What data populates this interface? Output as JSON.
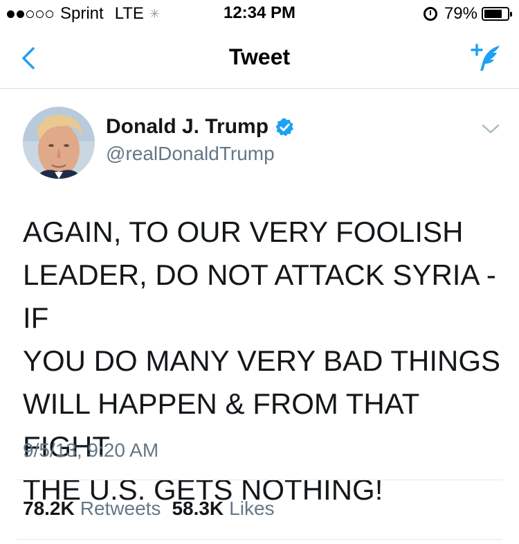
{
  "status_bar": {
    "carrier": "Sprint",
    "network": "LTE",
    "time": "12:34 PM",
    "battery_percent": "79%",
    "battery_level": 0.79,
    "signal_bars_filled": 2,
    "signal_bars_total": 5
  },
  "nav": {
    "title": "Tweet",
    "back_icon": "chevron-left-icon",
    "compose_icon": "compose-tweet-icon"
  },
  "tweet": {
    "display_name": "Donald J. Trump",
    "username": "@realDonaldTrump",
    "verified": true,
    "text_lines": [
      "AGAIN, TO OUR VERY FOOLISH",
      "LEADER, DO NOT ATTACK SYRIA - IF",
      "YOU DO MANY VERY BAD THINGS",
      "WILL HAPPEN & FROM THAT FIGHT",
      "THE U.S. GETS NOTHING!"
    ],
    "timestamp": "9/5/13, 9:20 AM"
  },
  "stats": {
    "retweets_count": "78.2K",
    "retweets_label": "Retweets",
    "likes_count": "58.3K",
    "likes_label": "Likes"
  },
  "colors": {
    "accent": "#1da1f2",
    "primary_text": "#14171a",
    "secondary_text": "#657786",
    "divider": "#e1e8ed"
  }
}
